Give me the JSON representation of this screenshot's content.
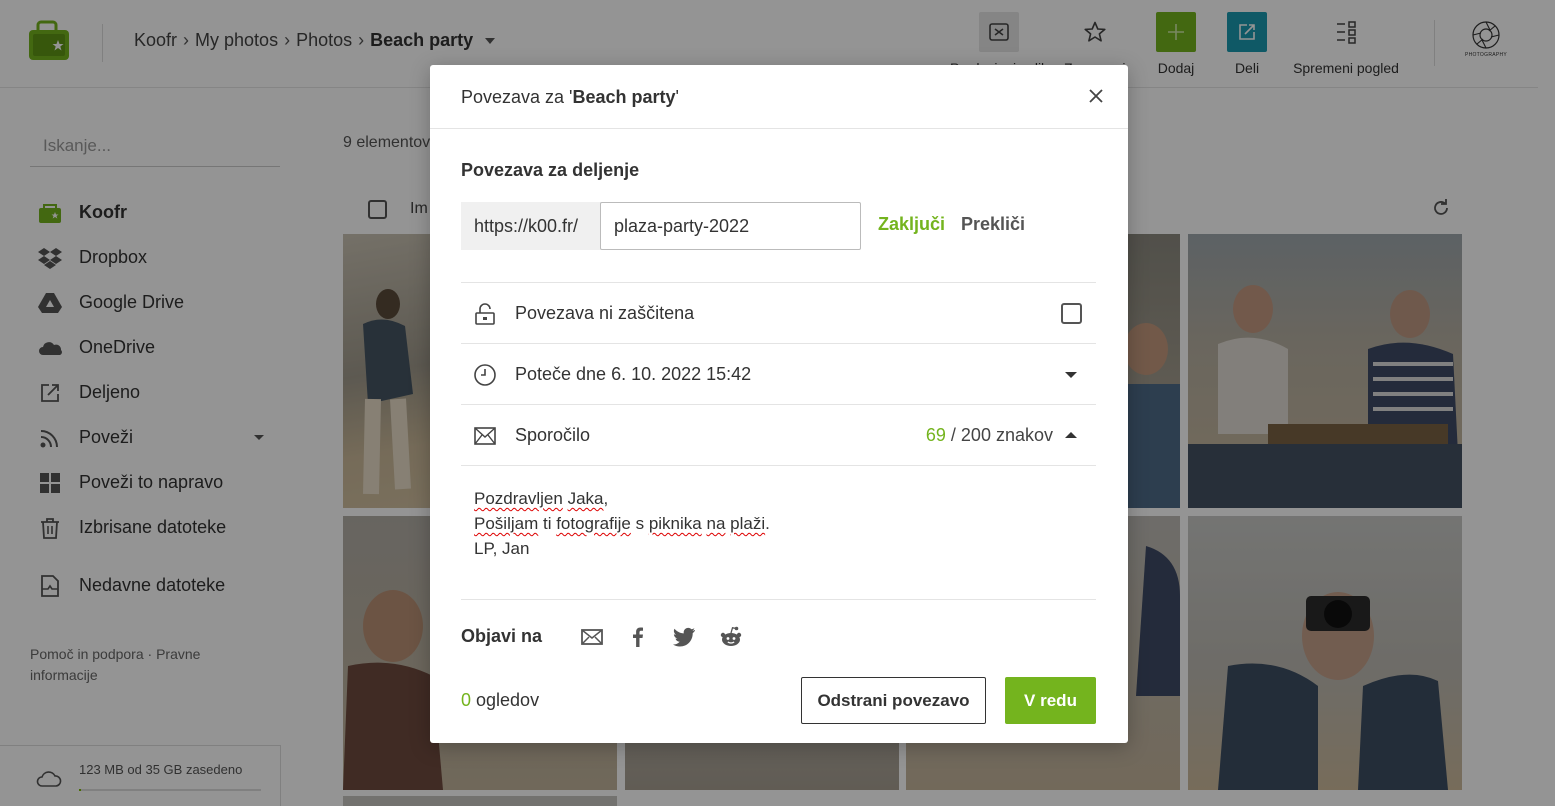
{
  "header": {
    "breadcrumb": [
      "Koofr",
      "My photos",
      "Photos"
    ],
    "breadcrumb_current": "Beach party",
    "tools": {
      "slideshow": "Predvajanje slik",
      "favorite": "Zaznamuj",
      "add": "Dodaj",
      "share": "Deli",
      "view": "Spremeni pogled"
    },
    "profile_text": "PHOTOGRAPHY",
    "colors": {
      "add_bg": "#74b41e",
      "share_bg": "#1a9ab0"
    }
  },
  "sidebar": {
    "search_placeholder": "Iskanje...",
    "items": [
      {
        "label": "Koofr",
        "icon": "koofr-icon"
      },
      {
        "label": "Dropbox",
        "icon": "dropbox-icon"
      },
      {
        "label": "Google Drive",
        "icon": "google-drive-icon"
      },
      {
        "label": "OneDrive",
        "icon": "onedrive-icon"
      },
      {
        "label": "Deljeno",
        "icon": "shared-icon"
      },
      {
        "label": "Poveži",
        "icon": "connect-icon"
      },
      {
        "label": "Poveži to napravo",
        "icon": "windows-icon"
      },
      {
        "label": "Izbrisane datoteke",
        "icon": "trash-icon"
      },
      {
        "label": "Nedavne datoteke",
        "icon": "recent-files-icon"
      }
    ],
    "footer_links": "Pomoč in podpora · Pravne informacije",
    "storage": "123 MB od 35 GB zasedeno",
    "storage_fraction": 0.0035
  },
  "content": {
    "count": "9 elementov",
    "select_label": "Im"
  },
  "modal": {
    "title_prefix": "Povezava za '",
    "title_name": "Beach party",
    "title_suffix": "'",
    "section_title": "Povezava za deljenje",
    "url_prefix": "https://k00.fr/",
    "url_value": "plaza-party-2022",
    "lock_label": "Zaključi",
    "cancel_label": "Prekliči",
    "protection_label": "Povezava ni zaščitena",
    "expiry_label": "Poteče dne 6. 10. 2022 15:42",
    "message_label": "Sporočilo",
    "message_count": "69",
    "message_max": " / 200 znakov",
    "message_lines": {
      "l1a": "Pozdravljen",
      "l1b": " ",
      "l1c": "Jaka",
      "l1d": ",",
      "l2a": "Pošiljam",
      "l2b": " ti ",
      "l2c": "fotografije",
      "l2d": " s ",
      "l2e": "piknika",
      "l2f": " ",
      "l2g": "na",
      "l2h": " ",
      "l2i": "plaži",
      "l2j": ".",
      "l3": "LP, Jan"
    },
    "share_on": "Objavi na",
    "views_count": "0",
    "views_label": " ogledov",
    "remove_button": "Odstrani povezavo",
    "ok_button": "V redu"
  }
}
